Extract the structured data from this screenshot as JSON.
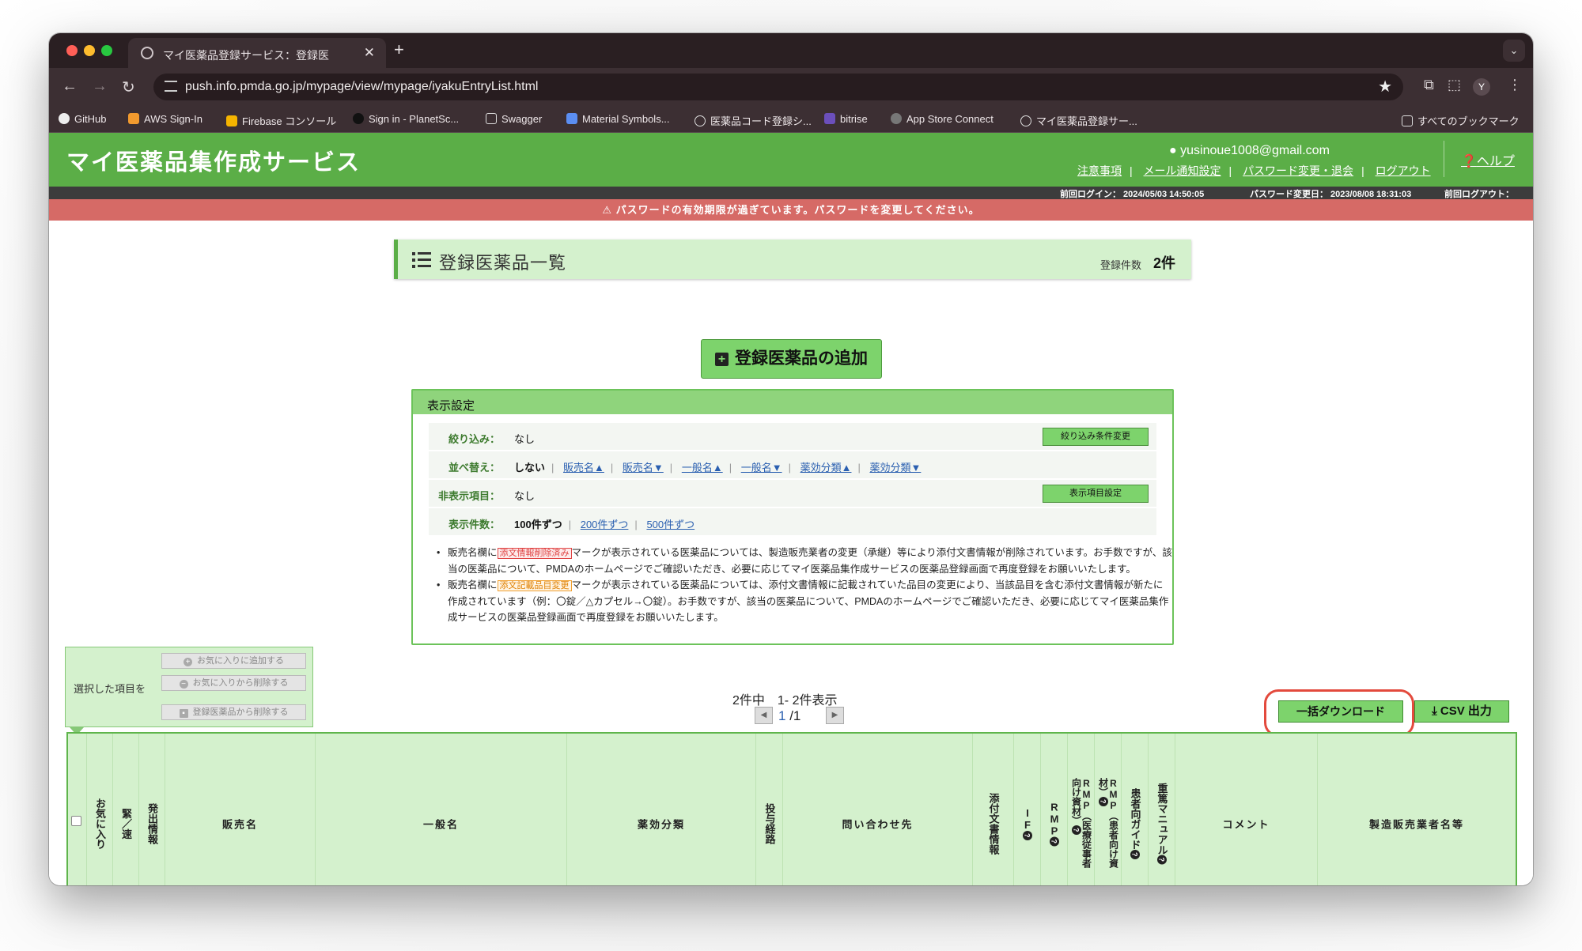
{
  "browser": {
    "tab_title": "マイ医薬品登録サービス：登録医",
    "url": "push.info.pmda.go.jp/mypage/view/mypage/iyakuEntryList.html",
    "profile_initial": "Y",
    "bookmarks": [
      "GitHub",
      "AWS Sign-In",
      "Firebase コンソール",
      "Sign in - PlanetSc...",
      "Swagger",
      "Material Symbols...",
      "医薬品コード登録シ...",
      "bitrise",
      "App Store Connect",
      "マイ医薬品登録サー..."
    ],
    "all_bookmarks": "すべてのブックマーク"
  },
  "header": {
    "site_title": "マイ医薬品集作成サービス",
    "user_email": "yusinoue1008@gmail.com",
    "links": [
      "注意事項",
      "メール通知設定",
      "パスワード変更・退会",
      "ログアウト"
    ],
    "help": "ヘルプ"
  },
  "login_info": {
    "last_login": "前回ログイン： 2024/05/03 14:50:05",
    "pw_changed": "パスワード変更日： 2023/08/08 18:31:03",
    "last_logout": "前回ログアウト："
  },
  "warning": "パスワードの有効期限が過ぎています。パスワードを変更してください。",
  "list": {
    "title": "登録医薬品一覧",
    "count_label": "登録件数",
    "count_value": "2件",
    "add_button": "登録医薬品の追加"
  },
  "settings": {
    "title": "表示設定",
    "filter_label": "絞り込み：",
    "filter_value": "なし",
    "filter_button": "絞り込み条件変更",
    "sort_label": "並べ替え：",
    "sort_current": "しない",
    "sort_options": [
      "販売名▲",
      "販売名▼",
      "一般名▲",
      "一般名▼",
      "薬効分類▲",
      "薬効分類▼"
    ],
    "hidden_label": "非表示項目：",
    "hidden_value": "なし",
    "hidden_button": "表示項目設定",
    "per_page_label": "表示件数：",
    "per_page_current": "100件ずつ",
    "per_page_options": [
      "200件ずつ",
      "500件ずつ"
    ],
    "note1_pre": "販売名欄に",
    "note1_tag": "添文情報削除済み",
    "note1_post": "マークが表示されている医薬品については、製造販売業者の変更（承継）等により添付文書情報が削除されています。お手数ですが、該当の医薬品について、PMDAのホームページでご確認いただき、必要に応じてマイ医薬品集作成サービスの医薬品登録画面で再度登録をお願いいたします。",
    "note2_pre": "販売名欄に",
    "note2_tag": "添文記載品目変更",
    "note2_post": "マークが表示されている医薬品については、添付文書情報に記載されていた品目の変更により、当該品目を含む添付文書情報が新たに作成されています（例：〇錠／△カプセル→〇錠）。お手数ですが、該当の医薬品について、PMDAのホームページでご確認いただき、必要に応じてマイ医薬品集作成サービスの医薬品登録画面で再度登録をお願いいたします。"
  },
  "bulk": {
    "label": "選択した項目を",
    "add_fav": "お気に入りに追加する",
    "remove_fav": "お気に入りから削除する",
    "remove_reg": "登録医薬品から削除する"
  },
  "pager": {
    "summary": "2件中　1- 2件表示",
    "current": "1",
    "total": "/1"
  },
  "actions": {
    "bulk_download": "一括ダウンロード",
    "csv": "CSV 出力"
  },
  "table": {
    "col_fav": "お気に入り",
    "col_urgent": "緊／速",
    "col_issue": "発出情報",
    "col_name": "販売名",
    "col_generic": "一般名",
    "col_class": "薬効分類",
    "col_route": "投与経路",
    "col_contact": "問い合わせ先",
    "col_doc": "添付文書情報",
    "col_if": "IF",
    "col_rmp": "RMP",
    "col_rmp_med": "RMP（医療従事者向け資材）",
    "col_rmp_pat": "RMP（患者向け資材）",
    "col_guide": "患者向ガイド",
    "col_manual": "重篤マニュアル",
    "col_comment": "コメント",
    "col_maker": "製造販売業者名等"
  }
}
